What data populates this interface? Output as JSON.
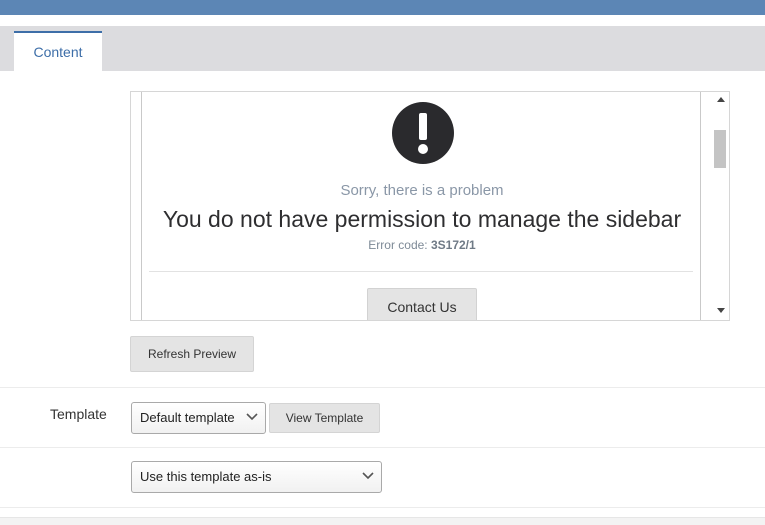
{
  "tabs": [
    {
      "label": "Content"
    }
  ],
  "preview": {
    "subtitle": "Sorry, there is a problem",
    "headline": "You do not have permission to manage the sidebar",
    "error_prefix": "Error code: ",
    "error_code": "3S172/1",
    "contact_label": "Contact Us"
  },
  "refresh_label": "Refresh Preview",
  "template": {
    "label": "Template",
    "selected": "Default template",
    "view_label": "View Template",
    "mode_selected": "Use this template as-is"
  },
  "colors": {
    "accent": "#3d6ea8",
    "header": "#5c86b5"
  }
}
